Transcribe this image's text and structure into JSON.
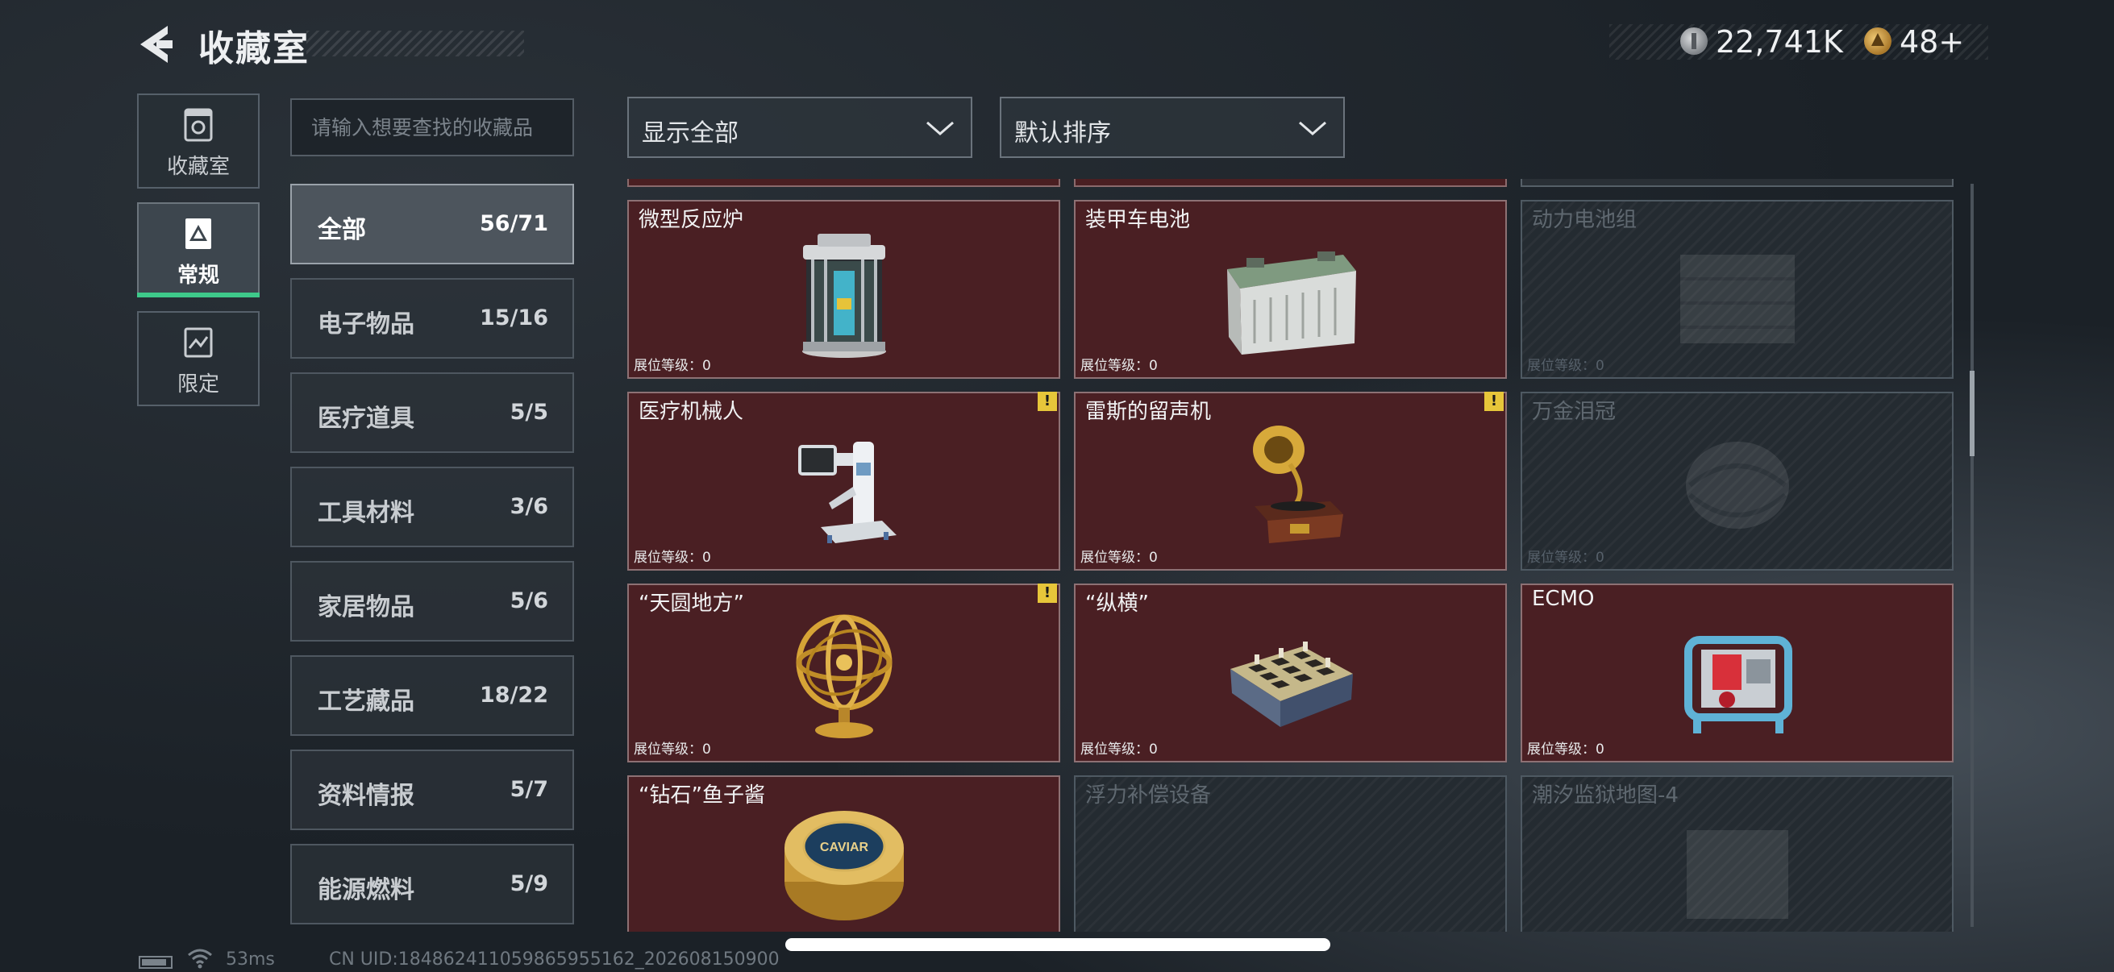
{
  "header": {
    "title": "收藏室",
    "currency": [
      {
        "icon": "coin-icon",
        "value": "22,741K"
      },
      {
        "icon": "ticket-icon",
        "value": "48+"
      }
    ]
  },
  "nav": {
    "tabs": [
      {
        "label": "收藏室",
        "icon": "vault-icon",
        "active": false
      },
      {
        "label": "常规",
        "icon": "regular-icon",
        "active": true
      },
      {
        "label": "限定",
        "icon": "limited-icon",
        "active": false
      }
    ]
  },
  "search": {
    "placeholder": "请输入想要查找的收藏品"
  },
  "categories": [
    {
      "label": "全部",
      "count": "56/71",
      "active": true
    },
    {
      "label": "电子物品",
      "count": "15/16"
    },
    {
      "label": "医疗道具",
      "count": "5/5"
    },
    {
      "label": "工具材料",
      "count": "3/6"
    },
    {
      "label": "家居物品",
      "count": "5/6"
    },
    {
      "label": "工艺藏品",
      "count": "18/22"
    },
    {
      "label": "资料情报",
      "count": "5/7"
    },
    {
      "label": "能源燃料",
      "count": "5/9"
    }
  ],
  "filters": {
    "display": "显示全部",
    "sort": "默认排序"
  },
  "grid": {
    "level_label": "展位等级：0",
    "warning_symbol": "!",
    "items": [
      {
        "name": "微型反应炉",
        "collected": true,
        "icon": "reactor-icon",
        "warning": false
      },
      {
        "name": "装甲车电池",
        "collected": true,
        "icon": "battery-icon",
        "warning": false
      },
      {
        "name": "动力电池组",
        "collected": false,
        "icon": "battery-pack-icon",
        "warning": false
      },
      {
        "name": "医疗机械人",
        "collected": true,
        "icon": "medical-robot-icon",
        "warning": true
      },
      {
        "name": "雷斯的留声机",
        "collected": true,
        "icon": "gramophone-icon",
        "warning": true
      },
      {
        "name": "万金泪冠",
        "collected": false,
        "icon": "crown-icon",
        "warning": false
      },
      {
        "name": "“天圆地方”",
        "collected": true,
        "icon": "armillary-sphere-icon",
        "warning": true
      },
      {
        "name": "“纵横”",
        "collected": true,
        "icon": "chessboard-icon",
        "warning": false
      },
      {
        "name": "ECMO",
        "collected": true,
        "icon": "ecmo-machine-icon",
        "warning": false
      },
      {
        "name": "“钻石”鱼子酱",
        "collected": true,
        "icon": "caviar-tin-icon",
        "warning": false
      },
      {
        "name": "浮力补偿设备",
        "collected": false,
        "icon": "buoyancy-device-icon",
        "warning": false
      },
      {
        "name": "潮汐监狱地图-4",
        "collected": false,
        "icon": "map-icon",
        "warning": false
      }
    ],
    "caviar_brand": "CAVIAR"
  },
  "footer": {
    "ping": "53ms",
    "uid": "CN UID:184862411059865955162_202608150900"
  }
}
